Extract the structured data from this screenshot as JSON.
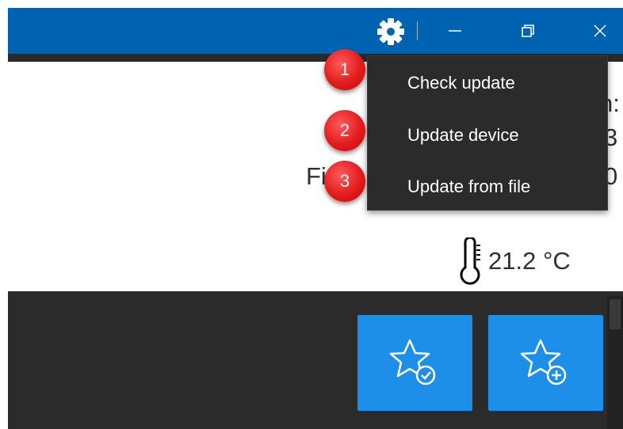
{
  "titlebar": {
    "settings_icon": "gear-icon",
    "minimize_icon": "minimize-icon",
    "restore_icon": "restore-icon",
    "close_icon": "close-icon",
    "background_color": "#0063b1"
  },
  "background_labels": {
    "line1": "n:",
    "line2": "3",
    "line3_left": "Firm",
    "line3_right": "0"
  },
  "menu": {
    "items": [
      {
        "label": "Check update"
      },
      {
        "label": "Update device"
      },
      {
        "label": "Update from file"
      }
    ]
  },
  "markers": [
    "1",
    "2",
    "3"
  ],
  "temperature": {
    "icon": "thermometer-icon",
    "value": "21.2 °C"
  },
  "actions": [
    {
      "icon": "star-check-icon"
    },
    {
      "icon": "star-add-icon"
    }
  ],
  "colors": {
    "accent_blue": "#1e8fe8",
    "marker_red": "#e31c1c",
    "menu_bg": "#2b2b2b"
  }
}
